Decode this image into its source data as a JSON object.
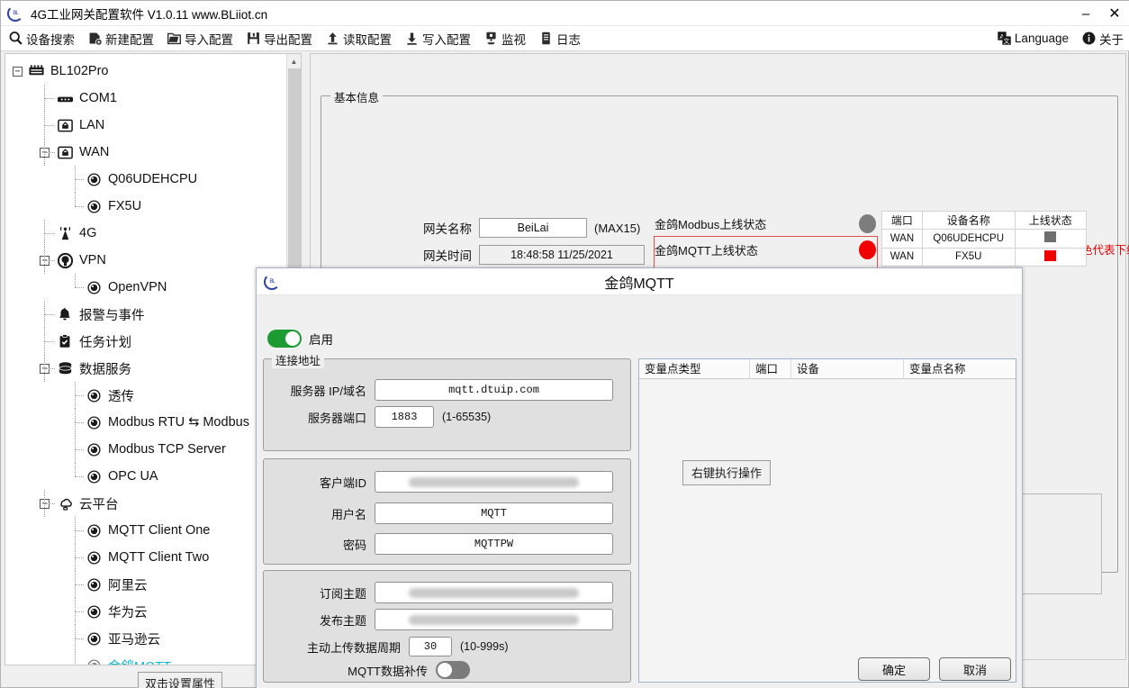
{
  "window": {
    "title": "4G工业网关配置软件 V1.0.11 www.BLiiot.cn",
    "logo_text": "BL",
    "minimize": "–",
    "close": "✕"
  },
  "toolbar": {
    "items": [
      {
        "label": "设备搜索",
        "icon": "search-icon"
      },
      {
        "label": "新建配置",
        "icon": "new-config-icon"
      },
      {
        "label": "导入配置",
        "icon": "import-folder-icon"
      },
      {
        "label": "导出配置",
        "icon": "save-disk-icon"
      },
      {
        "label": "读取配置",
        "icon": "upload-arrow-icon"
      },
      {
        "label": "写入配置",
        "icon": "download-arrow-icon"
      },
      {
        "label": "监视",
        "icon": "monitor-icon"
      },
      {
        "label": "日志",
        "icon": "log-icon"
      }
    ],
    "right_items": [
      {
        "label": "Language",
        "icon": "language-icon"
      },
      {
        "label": "关于",
        "icon": "info-icon"
      }
    ]
  },
  "tree": {
    "nodes": [
      {
        "label": "BL102Pro",
        "depth": 0,
        "icon": "gateway-icon",
        "expander": "−",
        "selected": false
      },
      {
        "label": "COM1",
        "depth": 1,
        "icon": "serial-icon",
        "expander": "",
        "selected": false
      },
      {
        "label": "LAN",
        "depth": 1,
        "icon": "ethernet-icon",
        "expander": "",
        "selected": false
      },
      {
        "label": "WAN",
        "depth": 1,
        "icon": "ethernet-icon",
        "expander": "−",
        "selected": false
      },
      {
        "label": "Q06UDEHCPU",
        "depth": 2,
        "icon": "node-icon",
        "expander": "",
        "selected": false
      },
      {
        "label": "FX5U",
        "depth": 2,
        "icon": "node-icon",
        "expander": "",
        "selected": false
      },
      {
        "label": "4G",
        "depth": 1,
        "icon": "antenna-icon",
        "expander": "",
        "selected": false
      },
      {
        "label": "VPN",
        "depth": 1,
        "icon": "vpn-icon",
        "expander": "−",
        "selected": false
      },
      {
        "label": "OpenVPN",
        "depth": 2,
        "icon": "node-icon",
        "expander": "",
        "selected": false
      },
      {
        "label": "报警与事件",
        "depth": 1,
        "icon": "bell-icon",
        "expander": "",
        "selected": false
      },
      {
        "label": "任务计划",
        "depth": 1,
        "icon": "clipboard-icon",
        "expander": "",
        "selected": false
      },
      {
        "label": "数据服务",
        "depth": 1,
        "icon": "database-icon",
        "expander": "−",
        "selected": false
      },
      {
        "label": "透传",
        "depth": 2,
        "icon": "node-icon",
        "expander": "",
        "selected": false
      },
      {
        "label": "Modbus RTU ⇆ Modbus",
        "depth": 2,
        "icon": "node-icon",
        "expander": "",
        "selected": false
      },
      {
        "label": "Modbus TCP Server",
        "depth": 2,
        "icon": "node-icon",
        "expander": "",
        "selected": false
      },
      {
        "label": "OPC UA",
        "depth": 2,
        "icon": "node-icon",
        "expander": "",
        "selected": false
      },
      {
        "label": "云平台",
        "depth": 1,
        "icon": "cloud-icon",
        "expander": "−",
        "selected": false
      },
      {
        "label": "MQTT Client One",
        "depth": 2,
        "icon": "node-icon",
        "expander": "",
        "selected": false
      },
      {
        "label": "MQTT Client Two",
        "depth": 2,
        "icon": "node-icon",
        "expander": "",
        "selected": false
      },
      {
        "label": "阿里云",
        "depth": 2,
        "icon": "node-icon",
        "expander": "",
        "selected": false
      },
      {
        "label": "华为云",
        "depth": 2,
        "icon": "node-icon",
        "expander": "",
        "selected": false
      },
      {
        "label": "亚马逊云",
        "depth": 2,
        "icon": "node-icon",
        "expander": "",
        "selected": false
      },
      {
        "label": "金鸽MQTT",
        "depth": 2,
        "icon": "node-icon",
        "expander": "",
        "selected": true
      }
    ],
    "property_hint": "双击设置属性"
  },
  "main": {
    "basic_info_title": "基本信息",
    "gateway_name_label": "网关名称",
    "gateway_name_value": "BeiLai",
    "gateway_name_suffix": "(MAX15)",
    "gateway_time_label": "网关时间",
    "gateway_time_value": "18:48:58 11/25/2021",
    "legend_note": "红色代表上线状态，灰色代表下线状态",
    "status_rows": [
      {
        "label": "金鸽Modbus上线状态",
        "state": "gray"
      },
      {
        "label": "金鸽MQTT上线状态",
        "state": "red"
      }
    ],
    "device_table": {
      "headers": [
        "端口",
        "设备名称",
        "上线状态"
      ],
      "rows": [
        {
          "port": "WAN",
          "device": "Q06UDEHCPU",
          "state": "gray"
        },
        {
          "port": "WAN",
          "device": "FX5U",
          "state": "red"
        }
      ]
    }
  },
  "dialog": {
    "title": "金鸽MQTT",
    "enable_label": "启用",
    "enable_state": "on",
    "conn_group_title": "连接地址",
    "server_label": "服务器 IP/域名",
    "server_value": "mqtt.dtuip.com",
    "port_label": "服务器端口",
    "port_value": "1883",
    "port_range": "(1-65535)",
    "client_id_label": "客户端ID",
    "client_id_value": "",
    "username_label": "用户名",
    "username_value": "MQTT",
    "password_label": "密码",
    "password_value": "MQTTPW",
    "sub_topic_label": "订阅主题",
    "sub_topic_value": "",
    "pub_topic_label": "发布主题",
    "pub_topic_value": "",
    "upload_period_label": "主动上传数据周期",
    "upload_period_value": "30",
    "upload_period_range": "(10-999s)",
    "resend_label": "MQTT数据补传",
    "resend_state": "off",
    "points_headers": [
      "变量点类型",
      "端口",
      "设备",
      "变量点名称"
    ],
    "points_hint": "右键执行操作",
    "ok_label": "确定",
    "cancel_label": "取消"
  },
  "colors": {
    "accent": "#19b6d8",
    "online": "#f20000",
    "offline": "#7d7d7d",
    "toggle_on": "#1b9b32",
    "warning_text": "#e00000"
  }
}
